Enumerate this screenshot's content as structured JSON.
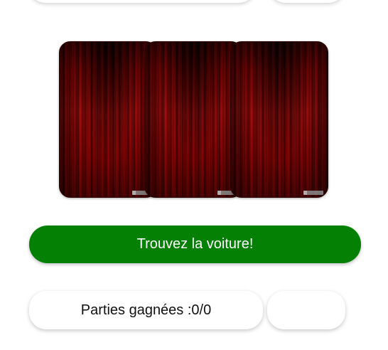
{
  "game": {
    "cards": [
      {
        "id": "card-1",
        "state": "face-down"
      },
      {
        "id": "card-2",
        "state": "face-down"
      },
      {
        "id": "card-3",
        "state": "face-down"
      }
    ],
    "card_back_icon": "red-curtain",
    "find_button_label": "Trouvez la voiture!",
    "score_label": "Parties gagnées :0/0",
    "reset_button_label": ""
  },
  "colors": {
    "primary_green": "#048004",
    "curtain_red": "#9a0a0a",
    "background": "#ffffff",
    "text_dark": "#111111"
  }
}
